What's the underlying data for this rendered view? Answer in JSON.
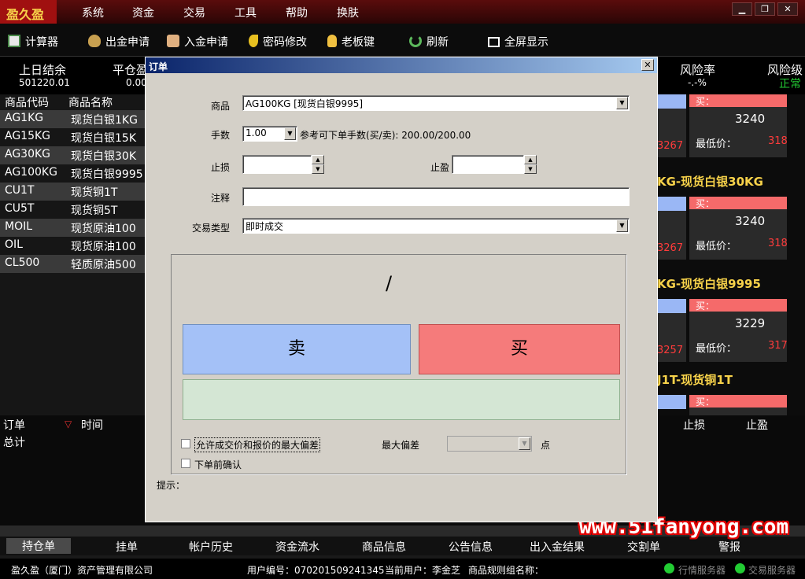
{
  "app": {
    "logo": "盈久盈"
  },
  "menu": [
    "系统",
    "资金",
    "交易",
    "工具",
    "帮助",
    "换肤"
  ],
  "window_controls": {
    "minimize": "▁",
    "restore": "❐",
    "close": "✕"
  },
  "toolbar": [
    "计算器",
    "出金申请",
    "入金申请",
    "密码修改",
    "老板键",
    "刷新",
    "全屏显示"
  ],
  "summary": {
    "prev_settle_label": "上日结余",
    "prev_settle_value": "501220.01",
    "close_pl_label": "平仓盈",
    "close_pl_value": "0.00",
    "risk_rate_label": "风险率",
    "risk_rate_value": "-.-%",
    "risk_level_label": "风险级",
    "risk_level_value": "正常"
  },
  "quote_list": {
    "header_code": "商品代码",
    "header_name": "商品名称",
    "rows": [
      {
        "code": "AG1KG",
        "name": "现货白银1KG"
      },
      {
        "code": "AG15KG",
        "name": "现货白银15K"
      },
      {
        "code": "AG30KG",
        "name": "现货白银30K"
      },
      {
        "code": "AG100KG",
        "name": "现货白银9995"
      },
      {
        "code": "CU1T",
        "name": "现货铜1T"
      },
      {
        "code": "CU5T",
        "name": "现货铜5T"
      },
      {
        "code": "MOIL",
        "name": "现货原油100"
      },
      {
        "code": "OIL",
        "name": "现货原油100"
      },
      {
        "code": "CL500",
        "name": "轻质原油500"
      }
    ]
  },
  "cards": [
    {
      "title": "",
      "left_value": "3267",
      "buy_label": "买：",
      "price": "3240",
      "low_label": "最低价：",
      "low_value": "318"
    },
    {
      "title": "KG-现货白银30KG",
      "left_value": "3267",
      "buy_label": "买：",
      "price": "3240",
      "low_label": "最低价：",
      "low_value": "318"
    },
    {
      "title": "KG-现货白银9995",
      "left_value": "3257",
      "buy_label": "买：",
      "price": "3229",
      "low_label": "最低价：",
      "low_value": "317"
    },
    {
      "title": "J1T-现货铜1T",
      "left_value": "",
      "buy_label": "买：",
      "price": "",
      "low_label": "",
      "low_value": ""
    }
  ],
  "orders": {
    "col_order": "订单",
    "sort_icon": "▽",
    "col_time": "时间",
    "col_stoploss": "止损",
    "col_takeprofit": "止盈",
    "total_label": "总计"
  },
  "tabs": [
    "持仓单",
    "挂单",
    "帐户历史",
    "资金流水",
    "商品信息",
    "公告信息",
    "出入金结果",
    "交割单",
    "警报"
  ],
  "status": {
    "company": "盈久盈（厦门）资产管理有限公司",
    "user_no": "用户编号：070201509241345",
    "current_user": "当前用户：李金芝",
    "rule_group": "商品规则组名称：",
    "quote_server": "行情服务器",
    "trade_server": "交易服务器"
  },
  "watermark": "www.51fanyong.com",
  "dialog": {
    "title": "订单",
    "close": "✕",
    "product_label": "商品",
    "product_value": "AG100KG [现货白银9995]",
    "lots_label": "手数",
    "lots_value": "1.00",
    "ref_lots": "参考可下单手数(买/卖): 200.00/200.00",
    "stoploss_label": "止损",
    "stoploss_value": "",
    "takeprofit_label": "止盈",
    "takeprofit_value": "",
    "comment_label": "注释",
    "comment_value": "",
    "trade_type_label": "交易类型",
    "trade_type_value": "即时成交",
    "price_display": "/",
    "sell_label": "卖",
    "buy_label": "买",
    "allow_deviation_label": "允许成交价和报价的最大偏差",
    "max_deviation_label": "最大偏差",
    "points_label": "点",
    "confirm_label": "下单前确认",
    "hint_label": "提示："
  }
}
